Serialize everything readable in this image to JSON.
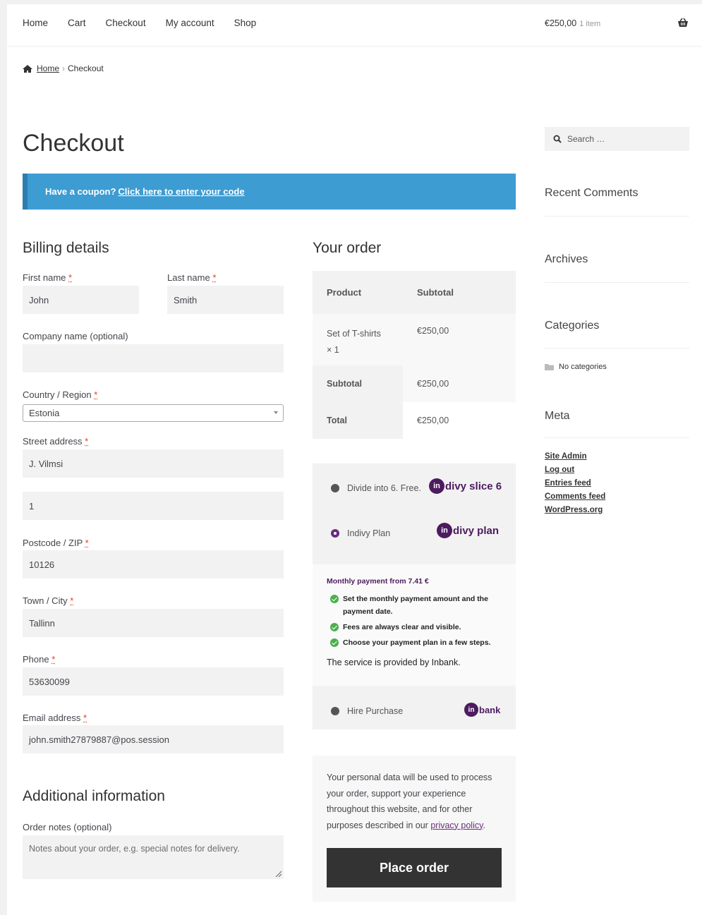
{
  "nav": {
    "items": [
      "Home",
      "Cart",
      "Checkout",
      "My account",
      "Shop"
    ]
  },
  "cart": {
    "total": "€250,00",
    "count": "1 item"
  },
  "breadcrumb": {
    "home": "Home",
    "current": "Checkout"
  },
  "page_title": "Checkout",
  "coupon": {
    "text": "Have a coupon?",
    "link": "Click here to enter your code"
  },
  "billing": {
    "heading": "Billing details",
    "first_name": {
      "label": "First name",
      "value": "John"
    },
    "last_name": {
      "label": "Last name",
      "value": "Smith"
    },
    "company": {
      "label": "Company name (optional)",
      "value": ""
    },
    "country": {
      "label": "Country / Region",
      "value": "Estonia"
    },
    "street": {
      "label": "Street address",
      "value1": "J. Vilmsi",
      "value2": "1"
    },
    "postcode": {
      "label": "Postcode / ZIP",
      "value": "10126"
    },
    "city": {
      "label": "Town / City",
      "value": "Tallinn"
    },
    "phone": {
      "label": "Phone",
      "value": "53630099"
    },
    "email": {
      "label": "Email address",
      "value": "john.smith27879887@pos.session"
    },
    "required_mark": "*"
  },
  "additional": {
    "heading": "Additional information",
    "notes_label": "Order notes (optional)",
    "notes_placeholder": "Notes about your order, e.g. special notes for delivery."
  },
  "order": {
    "heading": "Your order",
    "col_product": "Product",
    "col_subtotal": "Subtotal",
    "item_name": "Set of T-shirts",
    "item_qty": "× 1",
    "item_total": "€250,00",
    "subtotal_label": "Subtotal",
    "subtotal_value": "€250,00",
    "total_label": "Total",
    "total_value": "€250,00"
  },
  "payment": {
    "option1": {
      "label": "Divide into 6. Free.",
      "logo_text": "divy slice 6",
      "logo_mark": "in"
    },
    "option2": {
      "label": "Indivy Plan",
      "logo_text": "divy plan",
      "logo_mark": "in"
    },
    "desc_title": "Monthly payment from 7.41 €",
    "benefits": [
      "Set the monthly payment amount and the payment date.",
      "Fees are always clear and visible.",
      "Choose your payment plan in a few steps."
    ],
    "provider": "The service is provided by Inbank.",
    "option3": {
      "label": "Hire Purchase",
      "logo_text": "bank",
      "logo_mark": "in"
    },
    "accent": "#4d1b5f"
  },
  "privacy": {
    "text": "Your personal data will be used to process your order, support your experience throughout this website, and for other purposes described in our",
    "link": "privacy policy",
    "end": "."
  },
  "place_order": "Place order",
  "sidebar": {
    "search_placeholder": "Search …",
    "recent_comments": "Recent Comments",
    "archives": "Archives",
    "categories": "Categories",
    "no_categories": "No categories",
    "meta": "Meta",
    "meta_links": [
      "Site Admin",
      "Log out",
      "Entries feed",
      "Comments feed",
      "WordPress.org"
    ]
  },
  "colors": {
    "coupon_bg": "#3d9cd2",
    "button_bg": "#333333",
    "link": "#6b2d7b"
  }
}
